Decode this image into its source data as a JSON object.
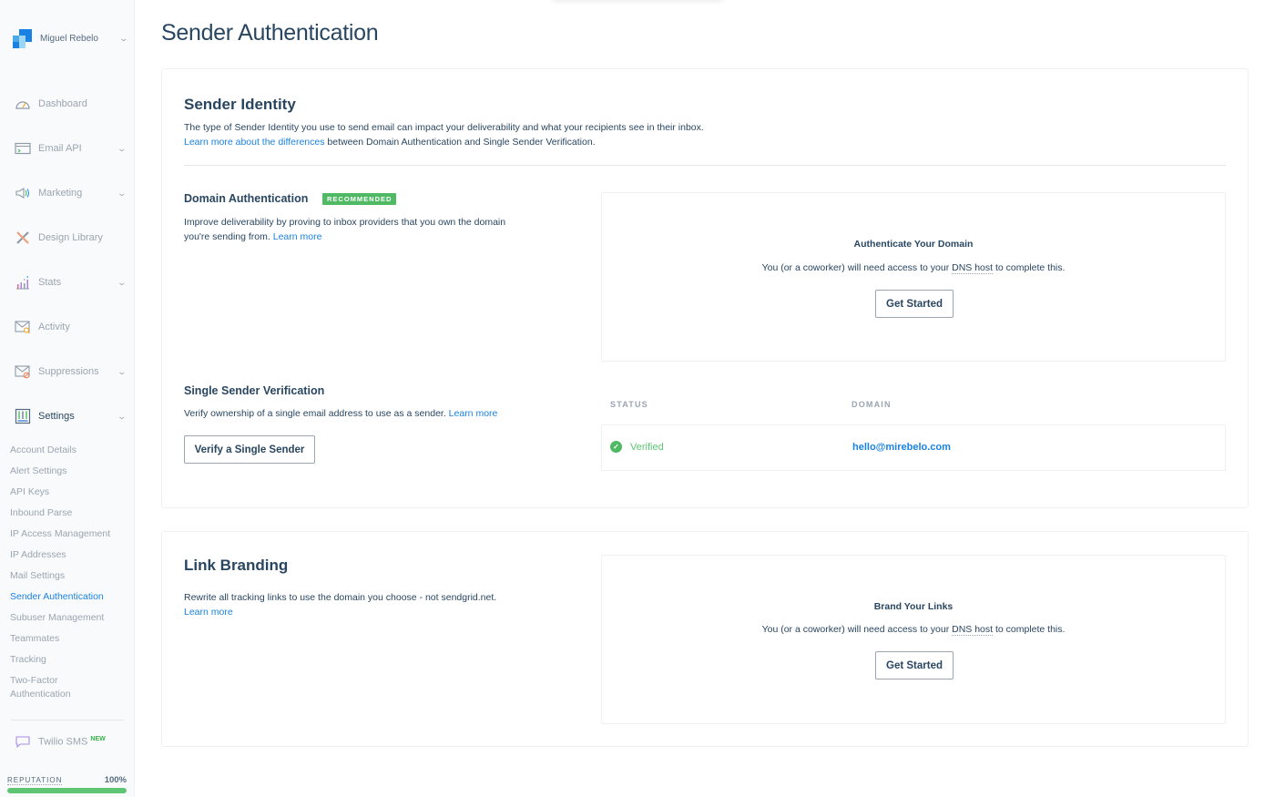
{
  "sidebar": {
    "account_name": "Miguel Rebelo",
    "nav": [
      {
        "label": "Dashboard",
        "icon": "dashboard-gauge-icon",
        "has_chevron": false
      },
      {
        "label": "Email API",
        "icon": "email-api-terminal-icon",
        "has_chevron": true
      },
      {
        "label": "Marketing",
        "icon": "megaphone-icon",
        "has_chevron": true
      },
      {
        "label": "Design Library",
        "icon": "design-tools-icon",
        "has_chevron": false
      },
      {
        "label": "Stats",
        "icon": "bar-chart-icon",
        "has_chevron": true
      },
      {
        "label": "Activity",
        "icon": "envelope-search-icon",
        "has_chevron": false
      },
      {
        "label": "Suppressions",
        "icon": "envelope-blocked-icon",
        "has_chevron": true
      },
      {
        "label": "Settings",
        "icon": "sliders-icon",
        "has_chevron": true
      }
    ],
    "settings_items": [
      "Account Details",
      "Alert Settings",
      "API Keys",
      "Inbound Parse",
      "IP Access Management",
      "IP Addresses",
      "Mail Settings",
      "Sender Authentication",
      "Subuser Management",
      "Teammates",
      "Tracking",
      "Two-Factor Authentication"
    ],
    "active_settings_item": "Sender Authentication",
    "twilio_sms": {
      "label": "Twilio SMS",
      "badge": "NEW"
    },
    "reputation": {
      "label": "REPUTATION",
      "value_text": "100%",
      "percent": 100
    }
  },
  "colors": {
    "accent": "#1a82e2",
    "text": "#294661",
    "muted": "#9aa5b1",
    "success": "#4fb964"
  },
  "main": {
    "page_title": "Sender Authentication",
    "sender_identity": {
      "title": "Sender Identity",
      "description": "The type of Sender Identity you use to send email can impact your deliverability and what your recipients see in their inbox.",
      "learn_link": "Learn more about the differences",
      "learn_suffix": " between Domain Authentication and Single Sender Verification.",
      "domain_auth": {
        "title": "Domain Authentication",
        "badge": "RECOMMENDED",
        "description": "Improve deliverability by proving to inbox providers that you own the domain you're sending from. ",
        "learn_link": "Learn more",
        "panel": {
          "title": "Authenticate Your Domain",
          "desc_prefix": "You (or a coworker) will need access to your ",
          "desc_term": "DNS host",
          "desc_suffix": " to complete this.",
          "button": "Get Started"
        }
      },
      "single_sender": {
        "title": "Single Sender Verification",
        "description": "Verify ownership of a single email address to use as a sender. ",
        "learn_link": "Learn more",
        "button": "Verify a Single Sender",
        "table": {
          "columns": [
            "STATUS",
            "DOMAIN"
          ],
          "rows": [
            {
              "status": "Verified",
              "domain": "hello@mirebelo.com"
            }
          ]
        }
      }
    },
    "link_branding": {
      "title": "Link Branding",
      "description": "Rewrite all tracking links to use the domain you choose - not sendgrid.net.",
      "learn_link": "Learn more",
      "panel": {
        "title": "Brand Your Links",
        "desc_prefix": "You (or a coworker) will need access to your ",
        "desc_term": "DNS host",
        "desc_suffix": " to complete this.",
        "button": "Get Started"
      }
    }
  }
}
